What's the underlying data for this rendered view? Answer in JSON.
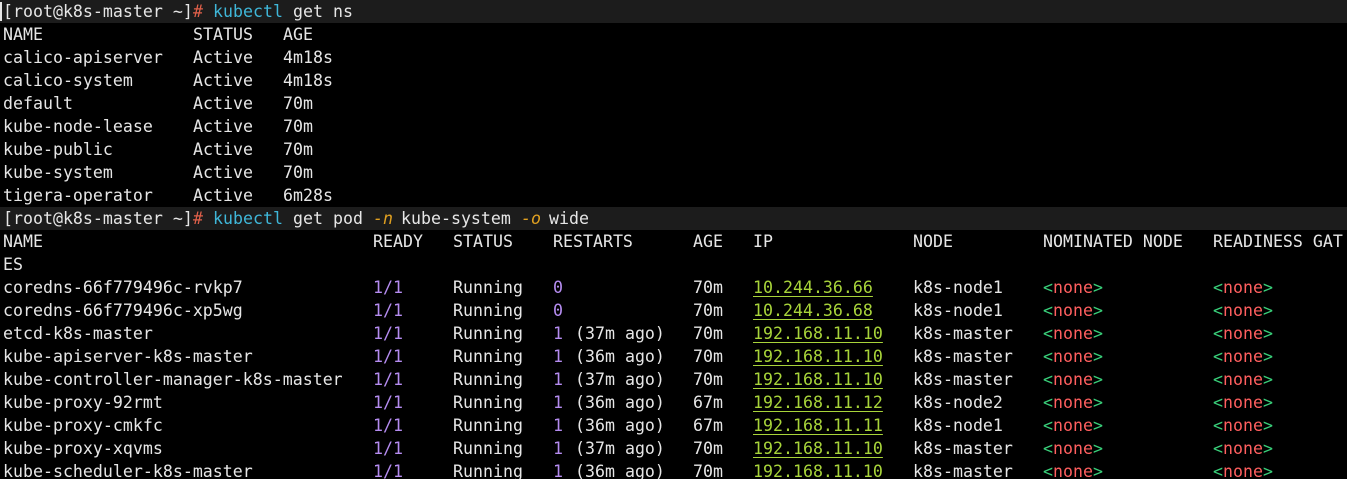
{
  "prompt": "[root@k8s-master ~]",
  "prompt_symbol": "#",
  "cmd1": {
    "command": "kubectl",
    "args": "get ns"
  },
  "ns_headers": [
    "NAME",
    "STATUS",
    "AGE"
  ],
  "namespaces": [
    [
      "calico-apiserver",
      "Active",
      "4m18s"
    ],
    [
      "calico-system",
      "Active",
      "4m18s"
    ],
    [
      "default",
      "Active",
      "70m"
    ],
    [
      "kube-node-lease",
      "Active",
      "70m"
    ],
    [
      "kube-public",
      "Active",
      "70m"
    ],
    [
      "kube-system",
      "Active",
      "70m"
    ],
    [
      "tigera-operator",
      "Active",
      "6m28s"
    ]
  ],
  "cmd2": {
    "command": "kubectl",
    "sub": "get pod",
    "flag_n": "-n",
    "ns": "kube-system",
    "flag_o": "-o",
    "output": "wide"
  },
  "pod_headers": [
    "NAME",
    "READY",
    "STATUS",
    "RESTARTS",
    "AGE",
    "IP",
    "NODE",
    "NOMINATED NODE",
    "READINESS GAT",
    "ES"
  ],
  "pods": [
    {
      "name": "coredns-66f779496c-rvkp7",
      "ready": "1/1",
      "status": "Running",
      "restarts": "0",
      "ago": "",
      "age": "70m",
      "ip": "10.244.36.66",
      "node": "k8s-node1",
      "nominated": "none",
      "readiness": "none"
    },
    {
      "name": "coredns-66f779496c-xp5wg",
      "ready": "1/1",
      "status": "Running",
      "restarts": "0",
      "ago": "",
      "age": "70m",
      "ip": "10.244.36.68",
      "node": "k8s-node1",
      "nominated": "none",
      "readiness": "none"
    },
    {
      "name": "etcd-k8s-master",
      "ready": "1/1",
      "status": "Running",
      "restarts": "1",
      "ago": "(37m ago)",
      "age": "70m",
      "ip": "192.168.11.10",
      "node": "k8s-master",
      "nominated": "none",
      "readiness": "none"
    },
    {
      "name": "kube-apiserver-k8s-master",
      "ready": "1/1",
      "status": "Running",
      "restarts": "1",
      "ago": "(36m ago)",
      "age": "70m",
      "ip": "192.168.11.10",
      "node": "k8s-master",
      "nominated": "none",
      "readiness": "none"
    },
    {
      "name": "kube-controller-manager-k8s-master",
      "ready": "1/1",
      "status": "Running",
      "restarts": "1",
      "ago": "(37m ago)",
      "age": "70m",
      "ip": "192.168.11.10",
      "node": "k8s-master",
      "nominated": "none",
      "readiness": "none"
    },
    {
      "name": "kube-proxy-92rmt",
      "ready": "1/1",
      "status": "Running",
      "restarts": "1",
      "ago": "(36m ago)",
      "age": "67m",
      "ip": "192.168.11.12",
      "node": "k8s-node2",
      "nominated": "none",
      "readiness": "none"
    },
    {
      "name": "kube-proxy-cmkfc",
      "ready": "1/1",
      "status": "Running",
      "restarts": "1",
      "ago": "(36m ago)",
      "age": "67m",
      "ip": "192.168.11.11",
      "node": "k8s-node1",
      "nominated": "none",
      "readiness": "none"
    },
    {
      "name": "kube-proxy-xqvms",
      "ready": "1/1",
      "status": "Running",
      "restarts": "1",
      "ago": "(37m ago)",
      "age": "70m",
      "ip": "192.168.11.10",
      "node": "k8s-master",
      "nominated": "none",
      "readiness": "none"
    },
    {
      "name": "kube-scheduler-k8s-master",
      "ready": "1/1",
      "status": "Running",
      "restarts": "1",
      "ago": "(36m ago)",
      "age": "70m",
      "ip": "192.168.11.10",
      "node": "k8s-master",
      "nominated": "none",
      "readiness": "none"
    }
  ],
  "colors": {
    "background": "#000000",
    "prompt_bar": "#1c1c1c",
    "text": "#e6e6e6",
    "hash": "#e0604a",
    "command": "#3fb7d9",
    "flag": "#e0a020",
    "number": "#b58cf0",
    "ip": "#a8d43a",
    "angle": "#39d07a",
    "none": "#ff5f5f"
  }
}
